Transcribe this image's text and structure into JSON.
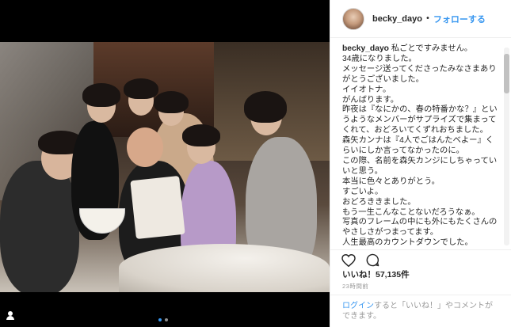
{
  "header": {
    "username": "becky_dayo",
    "separator": "•",
    "follow_label": "フォローする"
  },
  "caption": {
    "username": "becky_dayo",
    "text": " 私ごとですみません。\n34歳になりました。\nメッセージ送ってくださったみなさまありがとうございました。\nイイオトナ。\nがんばります。\n昨夜は『なにかの、春の特番かな？』というようなメンバーがサプライズで集まってくれて、おどろいてくずれおちました。\n森矢カンナは『4人でごはんたべよー』くらいにしか言ってなかったのに。\nこの際、名前を森矢カンジにしちゃっていいと思う。\n本当に色々とありがとう。\nすごいよ。\nおどろききました。\nもう一生こんなことないだろうなぁ。\n写真のフレームの中にも外にもたくさんのやさしさがつまってます。\n人生最高のカウントダウンでした。"
  },
  "icons": {
    "like": "heart-outline-icon",
    "comment": "speech-bubble-icon",
    "tagged": "person-icon"
  },
  "likes": {
    "text": "いいね！57,135件"
  },
  "time": {
    "text": "23時間前"
  },
  "login": {
    "link": "ログイン",
    "text": "すると「いいね！」やコメントができます。"
  },
  "carousel": {
    "current": 1,
    "total": 2
  }
}
